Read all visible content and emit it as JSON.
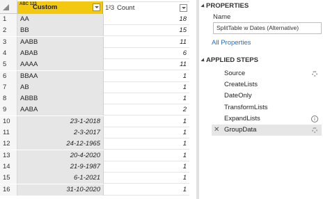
{
  "grid": {
    "columns": [
      {
        "name": "Custom",
        "type": "ABC 123"
      },
      {
        "name": "Count",
        "type": "1²3"
      }
    ],
    "rows": [
      {
        "index": "1",
        "custom": "AA",
        "count": "18"
      },
      {
        "index": "2",
        "custom": "BB",
        "count": "15"
      },
      {
        "index": "3",
        "custom": "AABB",
        "count": "11"
      },
      {
        "index": "4",
        "custom": "ABAB",
        "count": "6"
      },
      {
        "index": "5",
        "custom": "AAAA",
        "count": "11"
      },
      {
        "index": "6",
        "custom": "BBAA",
        "count": "1"
      },
      {
        "index": "7",
        "custom": "AB",
        "count": "1"
      },
      {
        "index": "8",
        "custom": "ABBB",
        "count": "1"
      },
      {
        "index": "9",
        "custom": "AABA",
        "count": "2"
      },
      {
        "index": "10",
        "custom": "23-1-2018",
        "count": "1"
      },
      {
        "index": "11",
        "custom": "2-3-2017",
        "count": "1"
      },
      {
        "index": "12",
        "custom": "24-12-1965",
        "count": "1"
      },
      {
        "index": "13",
        "custom": "20-4-2020",
        "count": "1"
      },
      {
        "index": "14",
        "custom": "21-9-1987",
        "count": "1"
      },
      {
        "index": "15",
        "custom": "6-1-2021",
        "count": "1"
      },
      {
        "index": "16",
        "custom": "31-10-2020",
        "count": "1"
      }
    ]
  },
  "properties": {
    "title": "PROPERTIES",
    "name_label": "Name",
    "name_value": "SplitTable w Dates (Alternative)",
    "all_properties_link": "All Properties"
  },
  "applied_steps": {
    "title": "APPLIED STEPS",
    "steps": [
      {
        "label": "Source",
        "icon": "gear-icon"
      },
      {
        "label": "CreateLists",
        "icon": ""
      },
      {
        "label": "DateOnly",
        "icon": ""
      },
      {
        "label": "TransformLists",
        "icon": ""
      },
      {
        "label": "ExpandLists",
        "icon": "info-icon"
      },
      {
        "label": "GroupData",
        "icon": "gear-icon",
        "active": true
      }
    ]
  },
  "colors": {
    "selected_column_header": "#f2c811",
    "selected_column_cells": "#e6e6e6",
    "link": "#1e6fcc"
  }
}
